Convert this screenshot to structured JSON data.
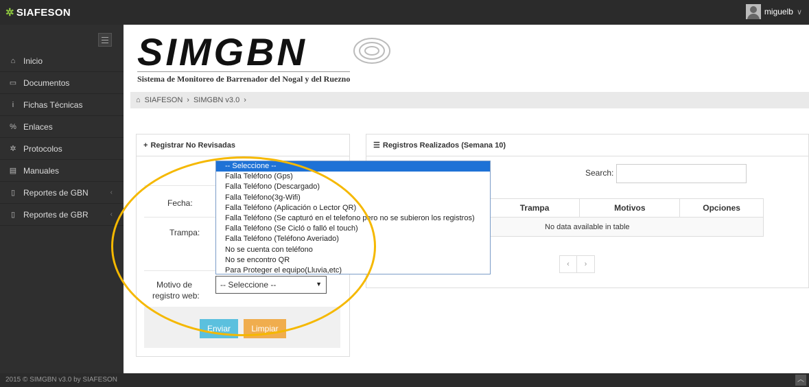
{
  "topbar": {
    "brand": "SIAFESON",
    "brand_icon": "leaf-icon",
    "username": "miguelb"
  },
  "sidebar": {
    "items": [
      {
        "label": "Inicio",
        "icon": "home-icon",
        "glyph": "⌂"
      },
      {
        "label": "Documentos",
        "icon": "folder-icon",
        "glyph": "▭"
      },
      {
        "label": "Fichas Técnicas",
        "icon": "info-icon",
        "glyph": "i"
      },
      {
        "label": "Enlaces",
        "icon": "link-icon",
        "glyph": "%"
      },
      {
        "label": "Protocolos",
        "icon": "gear-icon",
        "glyph": "✲"
      },
      {
        "label": "Manuales",
        "icon": "book-icon",
        "glyph": "▤"
      },
      {
        "label": "Reportes de GBN",
        "icon": "file-icon",
        "glyph": "▯",
        "chevron": "‹"
      },
      {
        "label": "Reportes de GBR",
        "icon": "file-icon",
        "glyph": "▯",
        "chevron": "‹"
      }
    ]
  },
  "logo": {
    "title": "SIMGBN",
    "subtitle": "Sistema de Monitoreo de Barrenador del Nogal y del Ruezno"
  },
  "breadcrumb": {
    "home": "SIAFESON",
    "sep1": "›",
    "current": "SIMGBN v3.0",
    "sep2": "›"
  },
  "left_panel": {
    "title": "Registrar No Revisadas",
    "labels": {
      "fecha": "Fecha:",
      "trampa": "Trampa:",
      "motivo_line1": "Motivo de",
      "motivo_line2": "registro web:"
    },
    "select_value": "-- Seleccione --",
    "send_label": "Enviar",
    "clear_label": "Limpiar"
  },
  "right_panel": {
    "title": "Registros Realizados (Semana 10)",
    "search_label": "Search:",
    "columns": [
      "Trampa",
      "Motivos",
      "Opciones"
    ],
    "empty_text": "No data available in table",
    "prev": "‹",
    "next": "›"
  },
  "dropdown": {
    "options": [
      "-- Seleccione --",
      "Falla Teléfono (Gps)",
      "Falla Teléfono (Descargado)",
      "Falla Teléfono(3g-Wifi)",
      "Falla Teléfono (Aplicación o Lector QR)",
      "Falla Teléfono (Se capturó en el telefono pero no se subieron los registros)",
      "Falla Teléfono (Se Cicló o falló el touch)",
      "Falla Teléfono (Teléfono Averiado)",
      "No se cuenta con teléfono",
      "No se encontro QR",
      "Para Proteger el equipo(Lluvia,etc)"
    ],
    "selected_index": 0
  },
  "footer": {
    "text": "2015 © SIMGBN v3.0 by SIAFESON"
  },
  "colors": {
    "highlight": "#f5b800",
    "send": "#5bc0de",
    "clear": "#f0ad4e",
    "selected_option": "#1e72d6",
    "sidebar": "#2f2f2f"
  }
}
